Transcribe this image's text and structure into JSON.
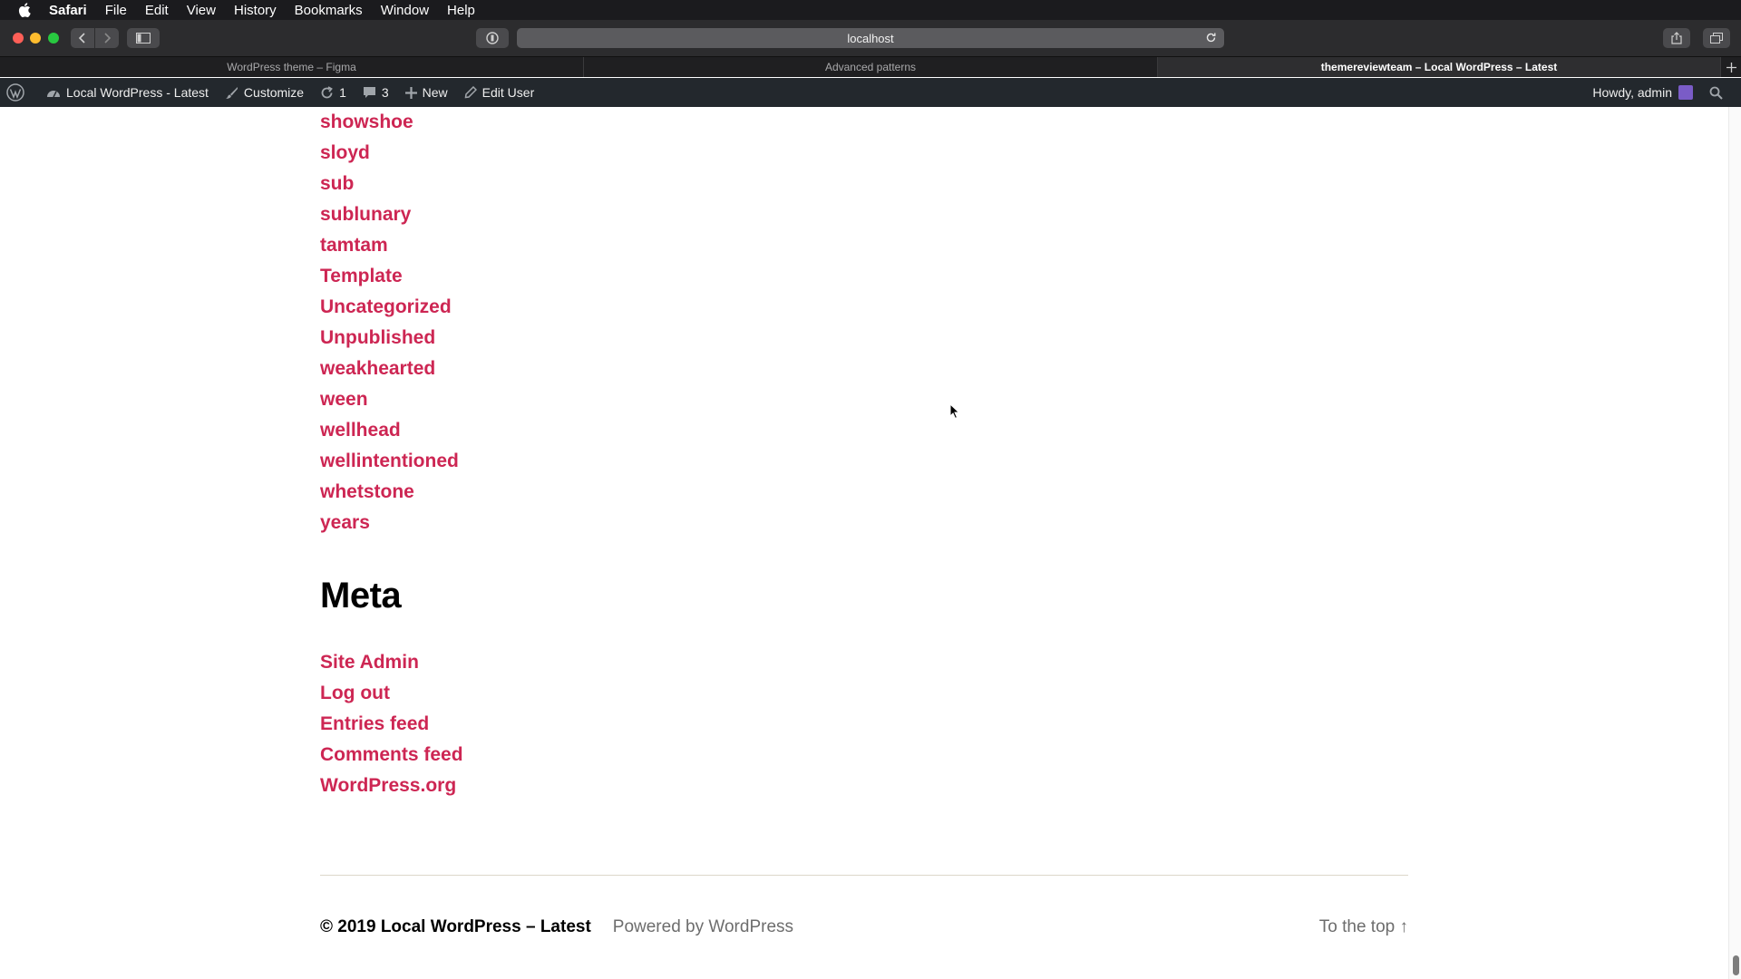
{
  "menubar": {
    "app": "Safari",
    "items": [
      "File",
      "Edit",
      "View",
      "History",
      "Bookmarks",
      "Window",
      "Help"
    ]
  },
  "address_bar": {
    "url": "localhost"
  },
  "tabs": [
    {
      "title": "WordPress theme – Figma",
      "active": false
    },
    {
      "title": "Advanced patterns",
      "active": false
    },
    {
      "title": "themereviewteam – Local WordPress – Latest",
      "active": true
    }
  ],
  "adminbar": {
    "site_name": "Local WordPress - Latest",
    "customize": "Customize",
    "updates_count": "1",
    "comments_count": "3",
    "new": "New",
    "edit_user": "Edit User",
    "howdy": "Howdy, admin"
  },
  "categories": [
    "showshoe",
    "sloyd",
    "sub",
    "sublunary",
    "tamtam",
    "Template",
    "Uncategorized",
    "Unpublished",
    "weakhearted",
    "ween",
    "wellhead",
    "wellintentioned",
    "whetstone",
    "years"
  ],
  "meta": {
    "heading": "Meta",
    "links": [
      "Site Admin",
      "Log out",
      "Entries feed",
      "Comments feed",
      "WordPress.org"
    ]
  },
  "footer": {
    "copyright": "© 2019 Local WordPress – Latest",
    "powered": "Powered by WordPress",
    "to_top": "To the top ↑"
  },
  "colors": {
    "link": "#cd2653",
    "adminbar_bg": "#23282d",
    "menubar_bg": "#1b1b1e"
  }
}
